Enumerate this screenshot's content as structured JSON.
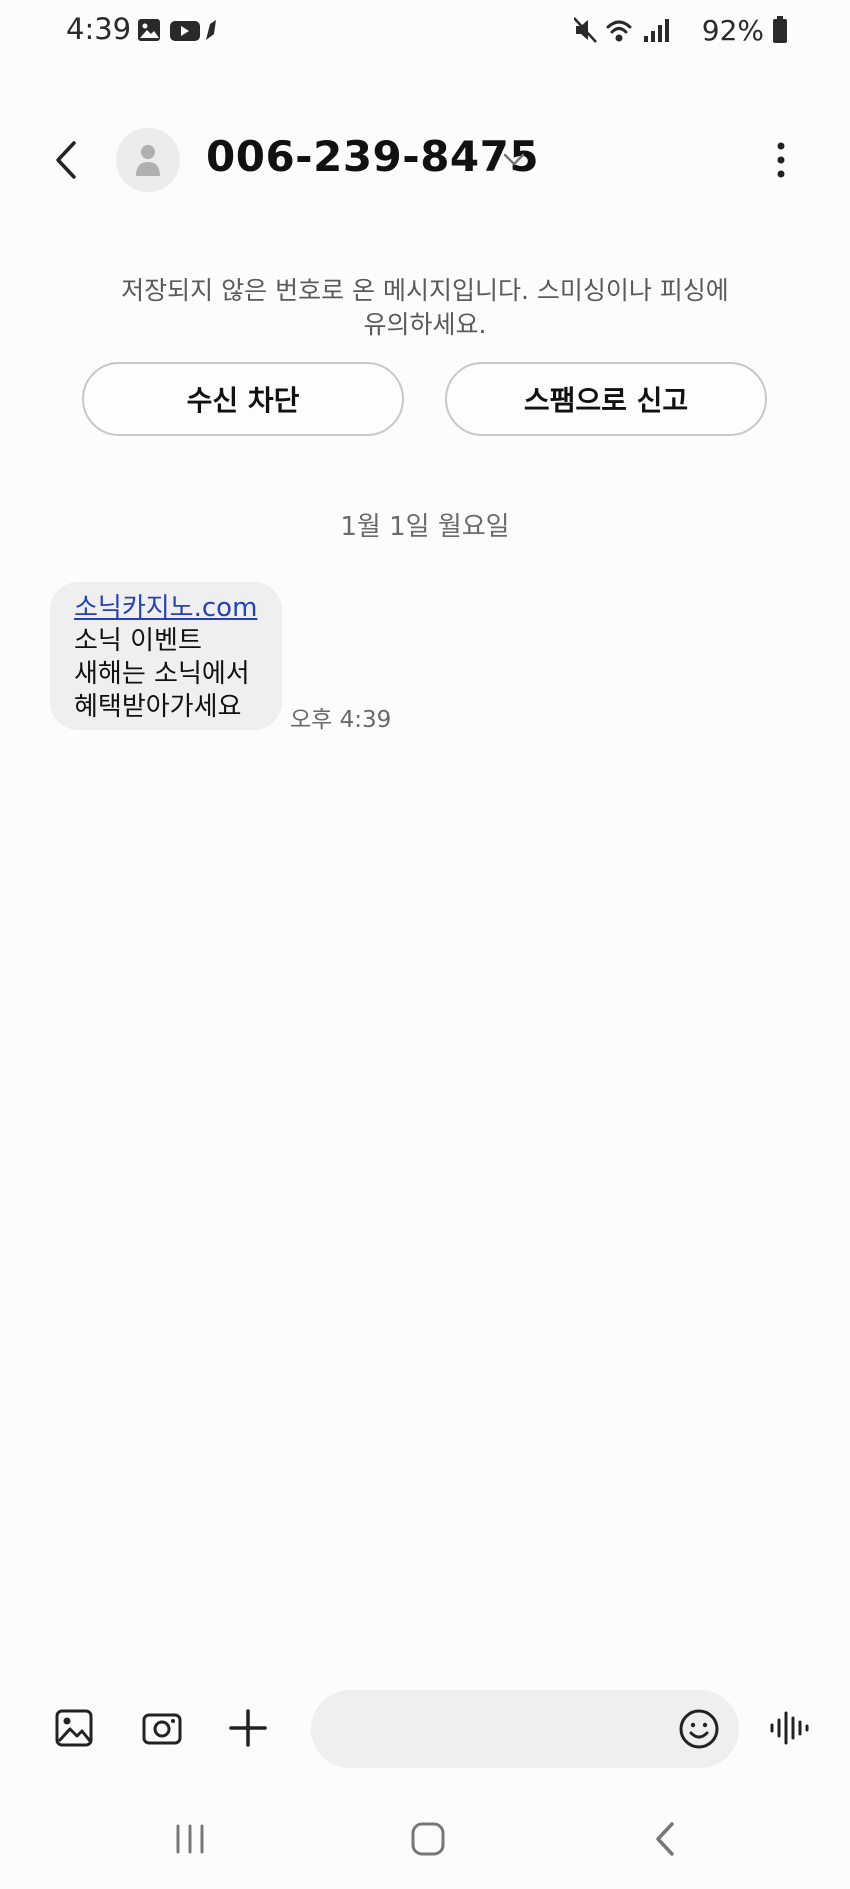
{
  "status_bar": {
    "time": "4:39",
    "battery_percent": "92%",
    "icons_left": [
      "gallery-icon",
      "youtube-icon",
      "app-notification-icon"
    ],
    "icons_right": [
      "mute-icon",
      "wifi-icon",
      "signal-icon",
      "battery-icon"
    ]
  },
  "header": {
    "contact": "006-239-8475"
  },
  "warning": {
    "line1": "저장되지 않은 번호로 온 메시지입니다. 스미싱이나 피싱에",
    "line2": "유의하세요.",
    "block_label": "수신 차단",
    "spam_label": "스팸으로 신고"
  },
  "conversation": {
    "date": "1월 1일 월요일",
    "messages": [
      {
        "link": "소닉카지노.com",
        "lines": [
          "소닉 이벤트",
          "새해는 소닉에서",
          "혜택받아가세요"
        ],
        "time": "오후 4:39"
      }
    ]
  },
  "compose": {
    "placeholder": ""
  },
  "colors": {
    "background": "#fcfcfc",
    "bubble": "#efefef",
    "link": "#2443b6",
    "muted_text": "#6a6a6a"
  }
}
